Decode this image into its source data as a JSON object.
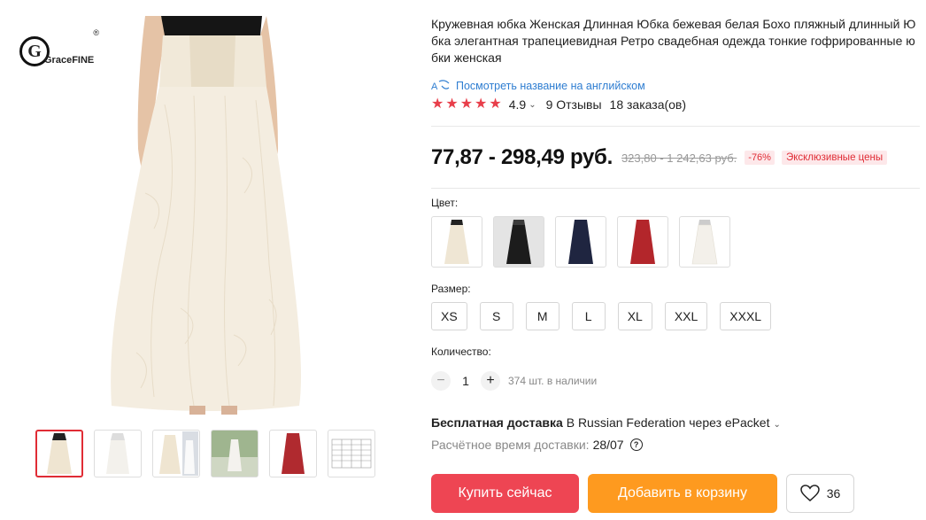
{
  "brand": {
    "logo_text": "GraceFINE",
    "reg_mark": "®"
  },
  "product": {
    "title": "Кружевная юбка Женская Длинная Юбка бежевая белая Бохо пляжный длинный Юбка элегантная трапециевидная Ретро свадебная одежда тонкие гофрированные юбки женская",
    "translate_link": "Посмотреть название на английском",
    "rating": "4.9",
    "rating_stars": 5,
    "reviews": "9 Отзывы",
    "orders": "18 заказа(ов)"
  },
  "price": {
    "current": "77,87 - 298,49 руб.",
    "old": "323,80 - 1 242,63 руб.",
    "discount": "-76%",
    "promo": "Эксклюзивные цены"
  },
  "color_section": {
    "label": "Цвет:",
    "options": [
      {
        "name": "beige",
        "color": "#efe6d4"
      },
      {
        "name": "black",
        "color": "#1c1c1c"
      },
      {
        "name": "navy",
        "color": "#1f2540"
      },
      {
        "name": "red",
        "color": "#b3262b"
      },
      {
        "name": "white",
        "color": "#f3f0ea"
      }
    ]
  },
  "size_section": {
    "label": "Размер:",
    "options": [
      "XS",
      "S",
      "M",
      "L",
      "XL",
      "XXL",
      "XXXL"
    ]
  },
  "quantity_section": {
    "label": "Количество:",
    "minus": "−",
    "plus": "+",
    "value": "1",
    "stock": "374 шт. в наличии"
  },
  "shipping": {
    "free_label": "Бесплатная доставка",
    "method": " В Russian Federation через ePacket",
    "eta_label": "Расчётное время доставки:",
    "eta_date": "28/07",
    "help_icon": "?"
  },
  "actions": {
    "buy_now": "Купить сейчас",
    "add_to_cart": "Добавить в корзину",
    "wishlist_count": "36"
  },
  "colors": {
    "accent_red": "#ee4553",
    "accent_orange": "#fe9a1f",
    "link_blue": "#2e7dd1",
    "star_red": "#e83e4a"
  }
}
